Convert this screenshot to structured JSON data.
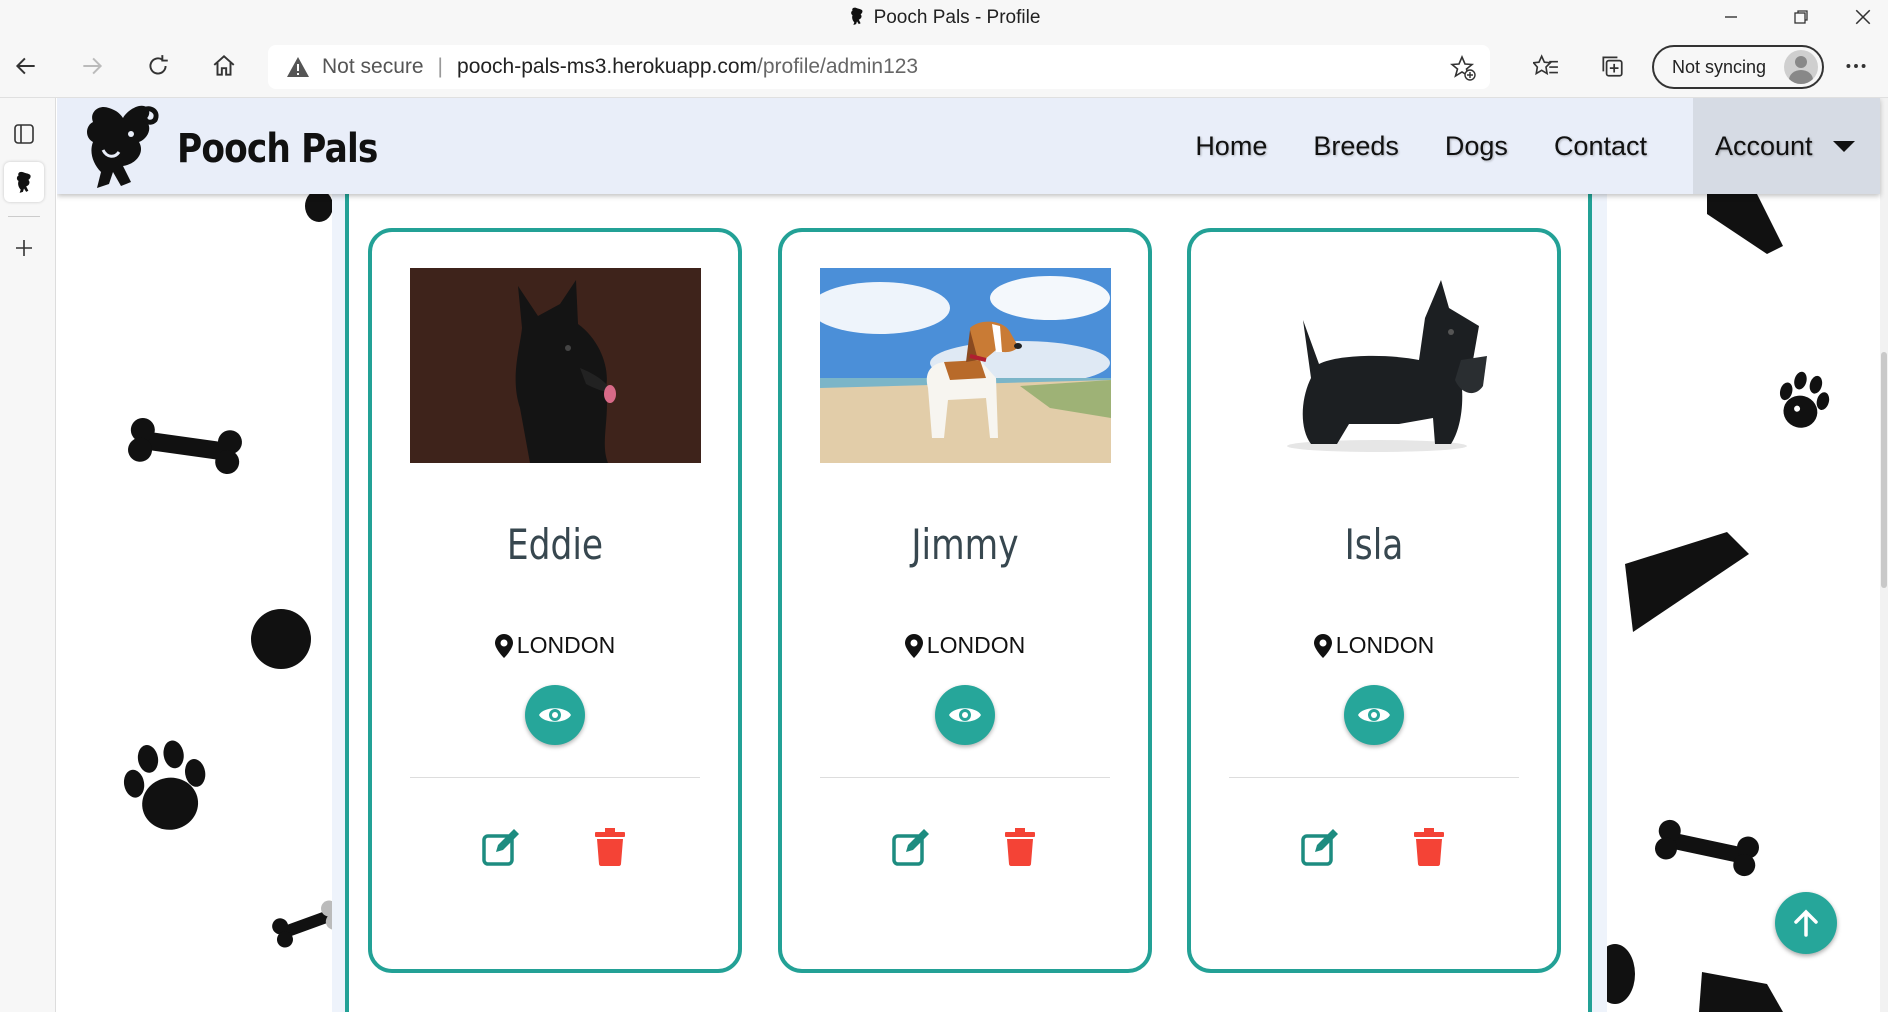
{
  "window": {
    "title": "Pooch Pals - Profile",
    "minimize_icon": "minimize-icon",
    "restore_icon": "restore-icon",
    "close_icon": "close-icon"
  },
  "browser": {
    "address": {
      "security_label": "Not secure",
      "separator": "|",
      "host": "pooch-pals-ms3.herokuapp.com",
      "path": "/profile/admin123"
    },
    "sync_label": "Not syncing"
  },
  "site": {
    "brand": "Pooch Pals",
    "nav": {
      "home": "Home",
      "breeds": "Breeds",
      "dogs": "Dogs",
      "contact": "Contact",
      "account": "Account"
    },
    "accent_color": "#26a69a",
    "delete_color": "#f44336",
    "navbar_color": "#e9eef9"
  },
  "dogs": [
    {
      "name": "Eddie",
      "location": "LONDON"
    },
    {
      "name": "Jimmy",
      "location": "LONDON"
    },
    {
      "name": "Isla",
      "location": "LONDON"
    }
  ]
}
